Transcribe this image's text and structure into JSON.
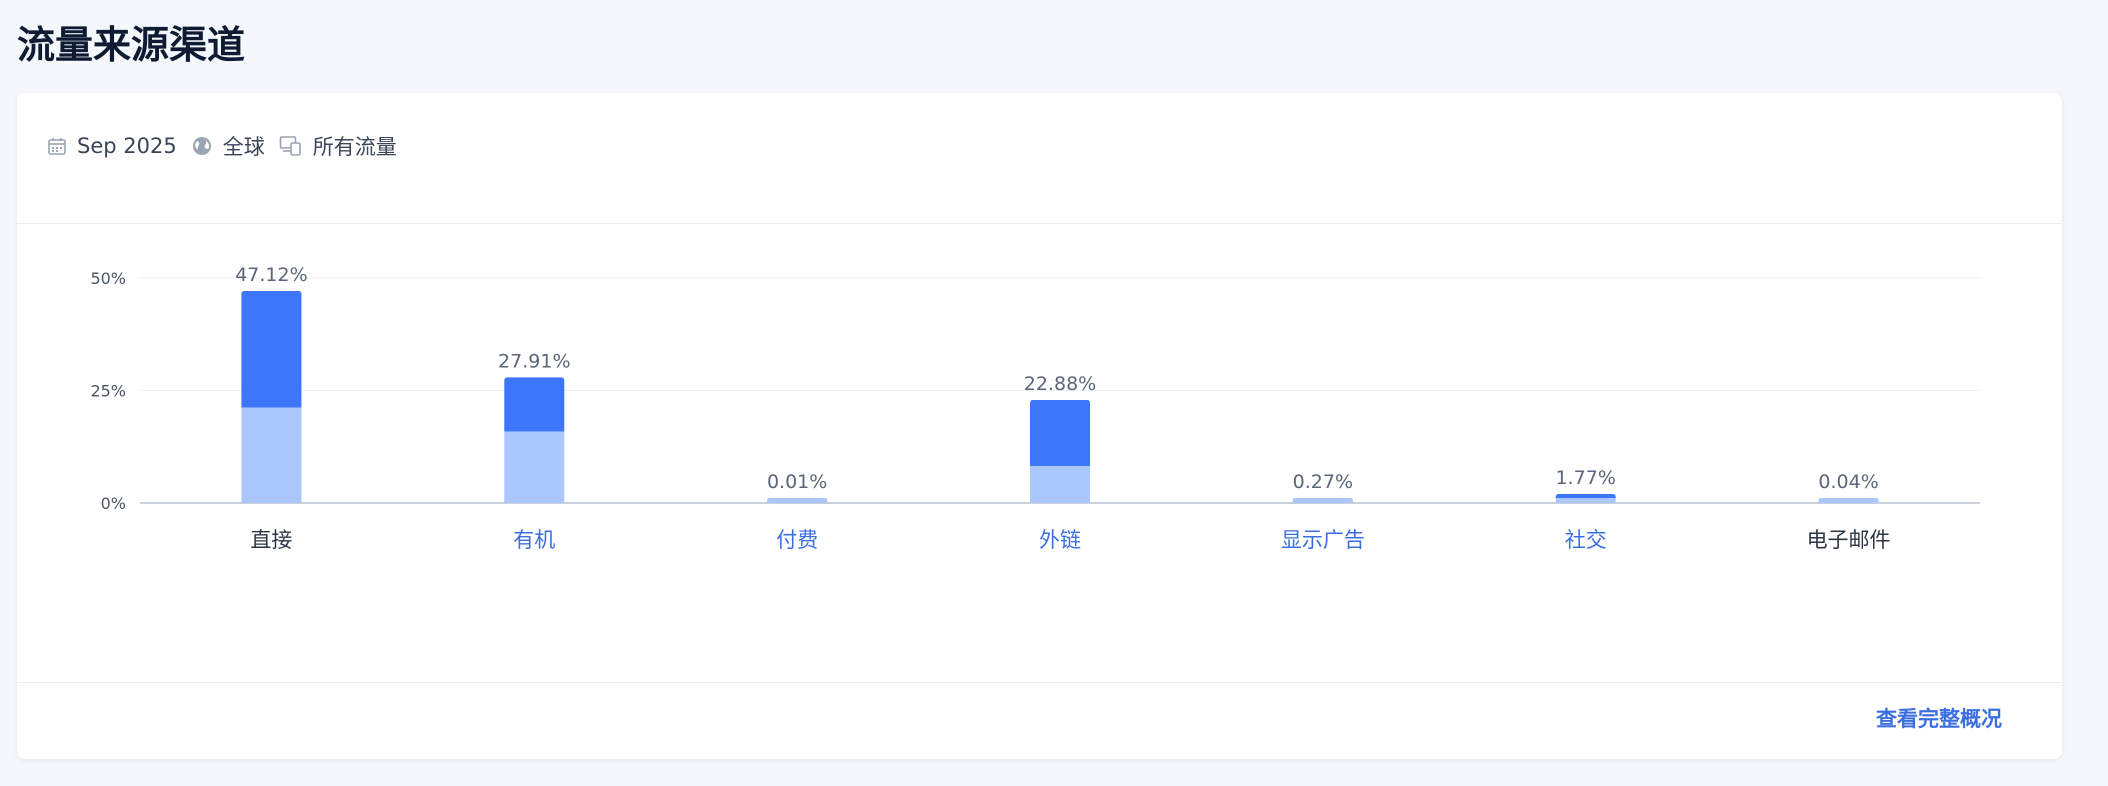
{
  "page": {
    "title": "流量来源渠道"
  },
  "filters": {
    "date": "Sep 2025",
    "region": "全球",
    "traffic": "所有流量"
  },
  "footer": {
    "view_full": "查看完整概况"
  },
  "colors": {
    "dark_bar": "#3d76f8",
    "light_bar": "#abc8fe",
    "link": "#3b6fe0"
  },
  "chart_data": {
    "type": "bar",
    "stacked": true,
    "categories": [
      "直接",
      "有机",
      "付费",
      "外链",
      "显示广告",
      "社交",
      "电子邮件"
    ],
    "category_is_link": [
      false,
      true,
      true,
      true,
      true,
      true,
      false
    ],
    "totals": [
      47.12,
      27.91,
      0.01,
      22.88,
      0.27,
      1.77,
      0.04
    ],
    "total_labels": [
      "47.12%",
      "27.91%",
      "0.01%",
      "22.88%",
      "0.27%",
      "1.77%",
      "0.04%"
    ],
    "series": [
      {
        "values": [
          21.2,
          15.9,
          0.01,
          8.2,
          0.27,
          0.9,
          0.04
        ]
      },
      {
        "values": [
          25.92,
          12.01,
          0,
          14.68,
          0,
          0.87,
          0
        ]
      }
    ],
    "yticks": [
      "0%",
      "25%",
      "50%"
    ],
    "ytick_values": [
      0,
      25,
      50
    ],
    "ylim": [
      0,
      50
    ],
    "grid": true
  }
}
